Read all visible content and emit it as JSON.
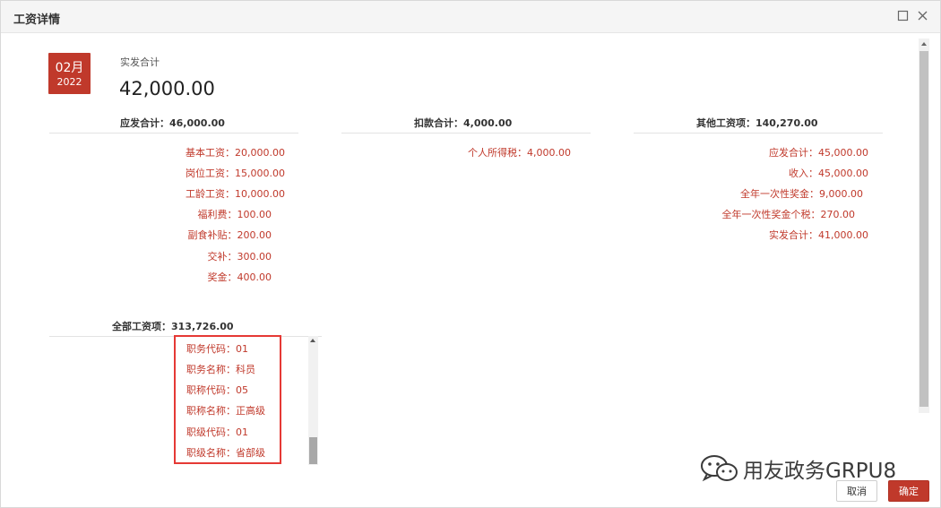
{
  "dialog": {
    "title": "工资详情"
  },
  "summary": {
    "month": "02月",
    "year": "2022",
    "label": "实发合计",
    "value": "42,000.00"
  },
  "columns": [
    {
      "title": "应发合计：",
      "value": "46,000.00"
    },
    {
      "title": "扣款合计：",
      "value": "4,000.00"
    },
    {
      "title": "其他工资项：",
      "value": "140,270.00"
    }
  ],
  "col1_items": [
    "基本工资：20,000.00",
    "岗位工资：15,000.00",
    "工龄工资：10,000.00",
    "福利费：100.00",
    "副食补贴：200.00",
    "交补：300.00",
    "奖金：400.00"
  ],
  "col2_items": [
    "个人所得税：4,000.00"
  ],
  "col3_items": [
    "应发合计：45,000.00",
    "收入：45,000.00",
    "全年一次性奖金：9,000.00",
    "全年一次性奖金个税：270.00",
    "实发合计：41,000.00"
  ],
  "total": {
    "title": "全部工资项：",
    "value": "313,726.00"
  },
  "total_items": [
    "职务代码：01",
    "职务名称：科员",
    "职称代码：05",
    "职称名称：正高级",
    "职级代码：01",
    "职级名称：省部级"
  ],
  "buttons": {
    "cancel": "取消",
    "ok": "确定"
  },
  "watermark": {
    "text": "用友政务GRPU8",
    "icon": "wechat-icon"
  },
  "colors": {
    "accent": "#c0392b",
    "highlight_border": "#e53935"
  }
}
